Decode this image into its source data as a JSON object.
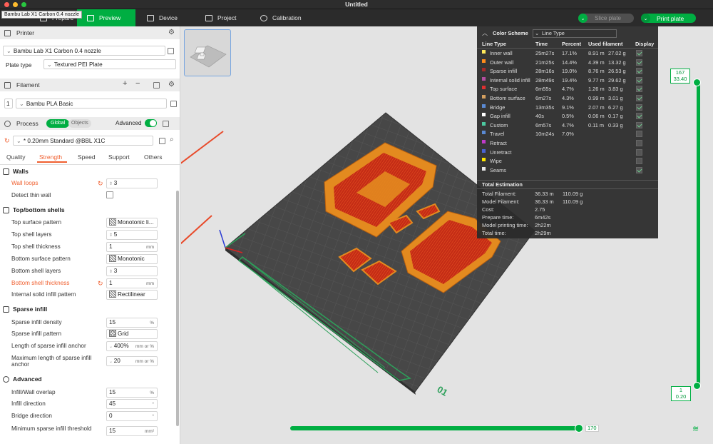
{
  "window": {
    "title": "Untitled",
    "tooltip": "Bambu Lab X1 Carbon 0.4 nozzle"
  },
  "topbar": {
    "tabs": [
      {
        "label": "Prepare"
      },
      {
        "label": "Preview"
      },
      {
        "label": "Device"
      },
      {
        "label": "Project"
      },
      {
        "label": "Calibration"
      }
    ],
    "slice_label": "Slice plate",
    "print_label": "Print plate"
  },
  "printer": {
    "section": "Printer",
    "printer_value": "Bambu Lab X1 Carbon 0.4 nozzle",
    "plate_type_label": "Plate type",
    "plate_type_value": "Textured PEI Plate"
  },
  "filament": {
    "section": "Filament",
    "slot": "1",
    "value": "Bambu PLA Basic"
  },
  "process": {
    "section": "Process",
    "toggle_global": "Global",
    "toggle_objects": "Objects",
    "advanced_label": "Advanced",
    "preset": "* 0.20mm Standard @BBL X1C",
    "tabs": [
      "Quality",
      "Strength",
      "Speed",
      "Support",
      "Others"
    ],
    "active_tab": "Strength"
  },
  "settings": {
    "walls": {
      "title": "Walls",
      "wall_loops_label": "Wall loops",
      "wall_loops_value": "3",
      "detect_thin_label": "Detect thin wall"
    },
    "topbottom": {
      "title": "Top/bottom shells",
      "top_surface_pattern_label": "Top surface pattern",
      "top_surface_pattern_value": "Monotonic li...",
      "top_shell_layers_label": "Top shell layers",
      "top_shell_layers_value": "5",
      "top_shell_thickness_label": "Top shell thickness",
      "top_shell_thickness_value": "1",
      "mm": "mm",
      "bottom_surface_pattern_label": "Bottom surface pattern",
      "bottom_surface_pattern_value": "Monotonic",
      "bottom_shell_layers_label": "Bottom shell layers",
      "bottom_shell_layers_value": "3",
      "bottom_shell_thickness_label": "Bottom shell thickness",
      "bottom_shell_thickness_value": "1",
      "internal_solid_label": "Internal solid infill pattern",
      "internal_solid_value": "Rectilinear"
    },
    "sparse": {
      "title": "Sparse infill",
      "density_label": "Sparse infill density",
      "density_value": "15",
      "percent": "%",
      "pattern_label": "Sparse infill pattern",
      "pattern_value": "Grid",
      "anchor_label": "Length of sparse infill anchor",
      "anchor_value": "400%",
      "anchor_unit": "mm or %",
      "maxanchor_label": "Maximum length of sparse infill anchor",
      "maxanchor_value": "20"
    },
    "advanced": {
      "title": "Advanced",
      "overlap_label": "Infill/Wall overlap",
      "overlap_value": "15",
      "direction_label": "Infill direction",
      "direction_value": "45",
      "bridge_label": "Bridge direction",
      "bridge_value": "0",
      "minsparse_label": "Minimum sparse infill threshold",
      "minsparse_value": "15",
      "mm2": "mm²"
    }
  },
  "color_scheme": {
    "title": "Color Scheme",
    "select": "Line Type",
    "headers": [
      "Line Type",
      "Time",
      "Percent",
      "Used filament",
      "Display"
    ],
    "rows": [
      {
        "name": "Inner wall",
        "time": "25m27s",
        "percent": "17.1%",
        "len": "8.91 m",
        "g": "27.02 g",
        "color": "#ffe95a",
        "on": true
      },
      {
        "name": "Outer wall",
        "time": "21m25s",
        "percent": "14.4%",
        "len": "4.39 m",
        "g": "13.32 g",
        "color": "#ff8c1a",
        "on": true
      },
      {
        "name": "Sparse infill",
        "time": "28m16s",
        "percent": "19.0%",
        "len": "8.76 m",
        "g": "26.53 g",
        "color": "#a52a2a",
        "on": true
      },
      {
        "name": "Internal solid infill",
        "time": "28m49s",
        "percent": "19.4%",
        "len": "9.77 m",
        "g": "29.62 g",
        "color": "#b44ea0",
        "on": true
      },
      {
        "name": "Top surface",
        "time": "6m55s",
        "percent": "4.7%",
        "len": "1.26 m",
        "g": "3.83 g",
        "color": "#e03030",
        "on": true
      },
      {
        "name": "Bottom surface",
        "time": "6m27s",
        "percent": "4.3%",
        "len": "0.99 m",
        "g": "3.01 g",
        "color": "#d4a060",
        "on": true
      },
      {
        "name": "Bridge",
        "time": "13m35s",
        "percent": "9.1%",
        "len": "2.07 m",
        "g": "6.27 g",
        "color": "#5a8ad4",
        "on": true
      },
      {
        "name": "Gap infill",
        "time": "40s",
        "percent": "0.5%",
        "len": "0.06 m",
        "g": "0.17 g",
        "color": "#ffffff",
        "on": true
      },
      {
        "name": "Custom",
        "time": "6m57s",
        "percent": "4.7%",
        "len": "0.11 m",
        "g": "0.33 g",
        "color": "#4cc9a0",
        "on": true
      },
      {
        "name": "Travel",
        "time": "10m24s",
        "percent": "7.0%",
        "len": "",
        "g": "",
        "color": "#5a8ad4",
        "on": false
      },
      {
        "name": "Retract",
        "time": "",
        "percent": "",
        "len": "",
        "g": "",
        "color": "#c03ac8",
        "on": false
      },
      {
        "name": "Unretract",
        "time": "",
        "percent": "",
        "len": "",
        "g": "",
        "color": "#4a64d4",
        "on": false
      },
      {
        "name": "Wipe",
        "time": "",
        "percent": "",
        "len": "",
        "g": "",
        "color": "#ffe600",
        "on": false
      },
      {
        "name": "Seams",
        "time": "",
        "percent": "",
        "len": "",
        "g": "",
        "color": "#e8e8e8",
        "on": true
      }
    ],
    "total_title": "Total Estimation",
    "totals": [
      {
        "k": "Total Filament:",
        "v1": "36.33 m",
        "v2": "110.09 g"
      },
      {
        "k": "Model Filament:",
        "v1": "36.33 m",
        "v2": "110.09 g"
      },
      {
        "k": "Cost:",
        "v1": "2.75",
        "v2": ""
      },
      {
        "k": "Prepare time:",
        "v1": "6m42s",
        "v2": ""
      },
      {
        "k": "Model printing time:",
        "v1": "2h22m",
        "v2": ""
      },
      {
        "k": "Total time:",
        "v1": "2h29m",
        "v2": ""
      }
    ]
  },
  "vertical_slider": {
    "top_layer": "167",
    "top_height": "33.40",
    "bottom_layer": "1",
    "bottom_height": "0.20"
  },
  "horizontal_slider": {
    "value": "170"
  },
  "plate": {
    "label": "01"
  }
}
